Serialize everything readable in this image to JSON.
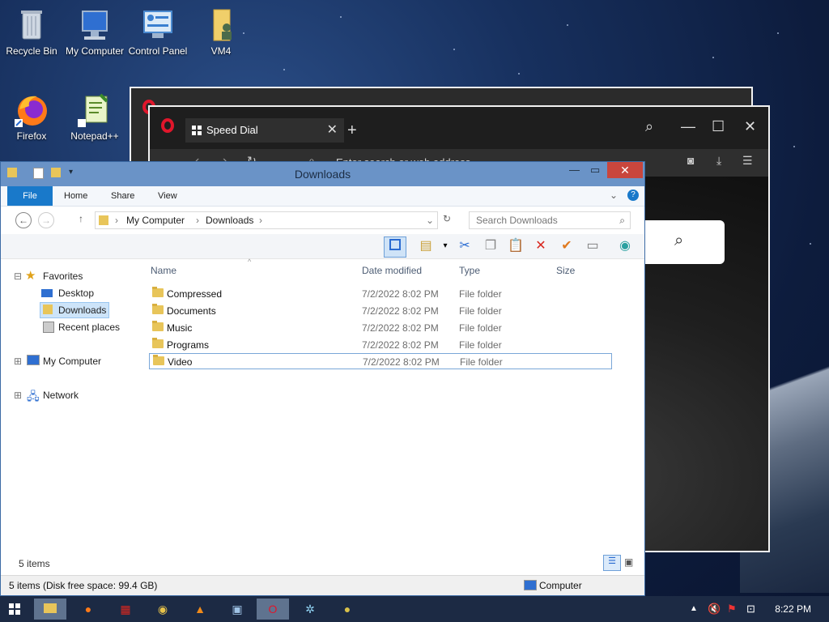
{
  "desktop": {
    "icons": [
      "Recycle Bin",
      "My Computer",
      "Control Panel",
      "VM4",
      "Firefox",
      "Notepad++"
    ]
  },
  "opera": {
    "tab_title": "Speed Dial",
    "address_placeholder": "Enter search or web address"
  },
  "explorer": {
    "title": "Downloads",
    "ribbon_tabs": [
      "File",
      "Home",
      "Share",
      "View"
    ],
    "breadcrumb": [
      "My Computer",
      "Downloads"
    ],
    "search_placeholder": "Search Downloads",
    "nav": {
      "favorites": "Favorites",
      "desktop": "Desktop",
      "downloads": "Downloads",
      "recent": "Recent places",
      "computer": "My Computer",
      "network": "Network"
    },
    "columns": [
      "Name",
      "Date modified",
      "Type",
      "Size"
    ],
    "files": [
      {
        "name": "Compressed",
        "date": "7/2/2022 8:02 PM",
        "type": "File folder"
      },
      {
        "name": "Documents",
        "date": "7/2/2022 8:02 PM",
        "type": "File folder"
      },
      {
        "name": "Music",
        "date": "7/2/2022 8:02 PM",
        "type": "File folder"
      },
      {
        "name": "Programs",
        "date": "7/2/2022 8:02 PM",
        "type": "File folder"
      },
      {
        "name": "Video",
        "date": "7/2/2022 8:02 PM",
        "type": "File folder"
      }
    ],
    "item_count": "5 items",
    "status": "5 items (Disk free space: 99.4 GB)",
    "status_location": "Computer"
  },
  "taskbar": {
    "time": "8:22 PM"
  },
  "colors": {
    "accent": "#1979ca",
    "title_bar": "#6a93c7",
    "close": "#c9463d",
    "taskbar": "#1c2a44"
  }
}
